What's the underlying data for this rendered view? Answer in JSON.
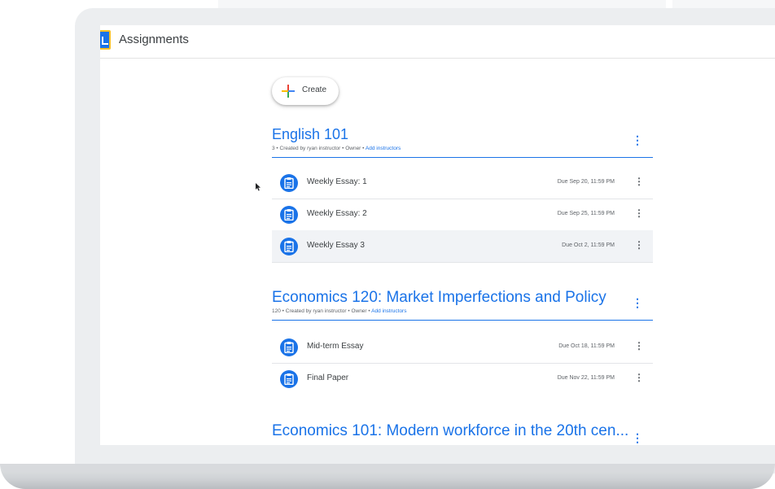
{
  "app": {
    "title": "Assignments",
    "logo_icon": "assignments-logo-icon"
  },
  "create_button": {
    "label": "Create",
    "icon": "colored-plus-icon"
  },
  "colors": {
    "accent": "#1a73e8",
    "text": "#3c4043",
    "muted": "#5f6368",
    "row_hover": "#f1f3f6"
  },
  "classes": [
    {
      "title": "English 101",
      "count": "3",
      "created_by": "Created by ryan instructor",
      "role": "Owner",
      "add_instructors": "Add instructors",
      "assignments": [
        {
          "title": "Weekly Essay: 1",
          "due": "Due Sep 20, 11:59 PM"
        },
        {
          "title": "Weekly Essay: 2",
          "due": "Due Sep 25, 11:59 PM"
        },
        {
          "title": "Weekly Essay 3",
          "due": "Due Oct 2, 11:59 PM"
        }
      ]
    },
    {
      "title": "Economics 120: Market Imperfections and Policy",
      "count": "120",
      "created_by": "Created by ryan instructor",
      "role": "Owner",
      "add_instructors": "Add instructors",
      "assignments": [
        {
          "title": "Mid-term Essay",
          "due": "Due Oct 18, 11:59 PM"
        },
        {
          "title": "Final Paper",
          "due": "Due Nov 22, 11:59 PM"
        }
      ]
    },
    {
      "title": "Economics 101: Modern workforce in the 20th cen..."
    }
  ],
  "separator": " • "
}
